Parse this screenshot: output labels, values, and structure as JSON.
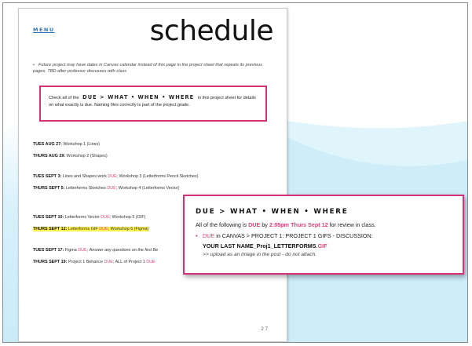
{
  "page": {
    "menu_label": "MENU",
    "title": "schedule",
    "note": "Future project may have dates in Canvas calendar instead of this page in the project sheet that repeats its previous pages. TBD after professor discusses with class",
    "check": {
      "before": "Check all of the",
      "header": "DUE > WHAT • WHEN • WHERE",
      "after": "in this project sheet for details on what exactly is due. Naming files correctly is part of the project grade."
    },
    "schedule": [
      {
        "date": "TUES AUG 27:",
        "text": "Workshop 1 (Lines)"
      },
      {
        "date": "THURS AUG 29:",
        "text": "Workshop 2 (Shapes)"
      },
      {
        "date": "TUES SEPT 3:",
        "pre": "Lines and Shapes work",
        "due": "DUE",
        "post": "; Workshop 3 (Letterforms Pencil Sketches)"
      },
      {
        "date": "THURS SEPT 5:",
        "pre": "Letterforms Sketches",
        "due": "DUE",
        "post": "; Workshop 4 (Letterforms Vector)"
      },
      {
        "date": "TUES SEPT 10:",
        "pre": "Letterforms Vector",
        "due": "DUE",
        "post": "; Workshop 5 (GIF)"
      },
      {
        "date": "THURS SEPT 12:",
        "pre": "Letterforms GIF",
        "due": "DUE",
        "post": "; Workshop 6 (Figma)"
      },
      {
        "date": "TUES SEPT 17:",
        "pre": "Figma",
        "due": "DUE",
        "post": ";",
        "post_italic": "Answer any questions on the first Be"
      },
      {
        "date": "THURS SEPT 19:",
        "pre": "Project 1 Behance",
        "due": "DUE",
        "post": "; ALL of Project 1",
        "due2": "DUE"
      }
    ],
    "page_number": "27"
  },
  "callout": {
    "header": "DUE > WHAT • WHEN • WHERE",
    "line1_pre": "All of the following is",
    "line1_due": "DUE",
    "line1_mid": "by",
    "line1_time": "2:05pm Thurs Sept 12",
    "line1_post": "for review in class.",
    "line2_due": "DUE",
    "line2_rest": "in CANVAS > PROJECT 1: PROJECT 1 GIFS - DISCUSSION:",
    "line3_name": "YOUR LAST NAME_Proj1_LETTERFORMS",
    "line3_ext": ".GIF",
    "line4": ">> upload as an image in the post - do not attach."
  },
  "colors": {
    "accent_pink": "#d6307b",
    "due_pink": "#e0407a",
    "highlight_yellow": "#fff34d",
    "link_blue": "#2f77b8"
  }
}
